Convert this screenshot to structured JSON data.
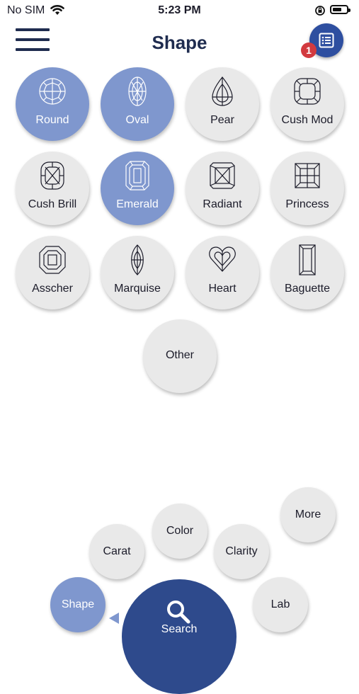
{
  "status_bar": {
    "carrier": "No SIM",
    "time": "5:23 PM"
  },
  "header": {
    "title": "Shape",
    "badge_count": "1"
  },
  "shapes": [
    {
      "label": "Round",
      "selected": true
    },
    {
      "label": "Oval",
      "selected": true
    },
    {
      "label": "Pear",
      "selected": false
    },
    {
      "label": "Cush Mod",
      "selected": false
    },
    {
      "label": "Cush Brill",
      "selected": false
    },
    {
      "label": "Emerald",
      "selected": true
    },
    {
      "label": "Radiant",
      "selected": false
    },
    {
      "label": "Princess",
      "selected": false
    },
    {
      "label": "Asscher",
      "selected": false
    },
    {
      "label": "Marquise",
      "selected": false
    },
    {
      "label": "Heart",
      "selected": false
    },
    {
      "label": "Baguette",
      "selected": false
    },
    {
      "label": "Other",
      "selected": false
    }
  ],
  "menu": {
    "shape": "Shape",
    "carat": "Carat",
    "color": "Color",
    "clarity": "Clarity",
    "more": "More",
    "lab": "Lab",
    "search": "Search"
  },
  "colors": {
    "selected": "#7f97ce",
    "unselected": "#e9e9e9",
    "primary": "#2e4a8c",
    "badge": "#d23a3f"
  }
}
